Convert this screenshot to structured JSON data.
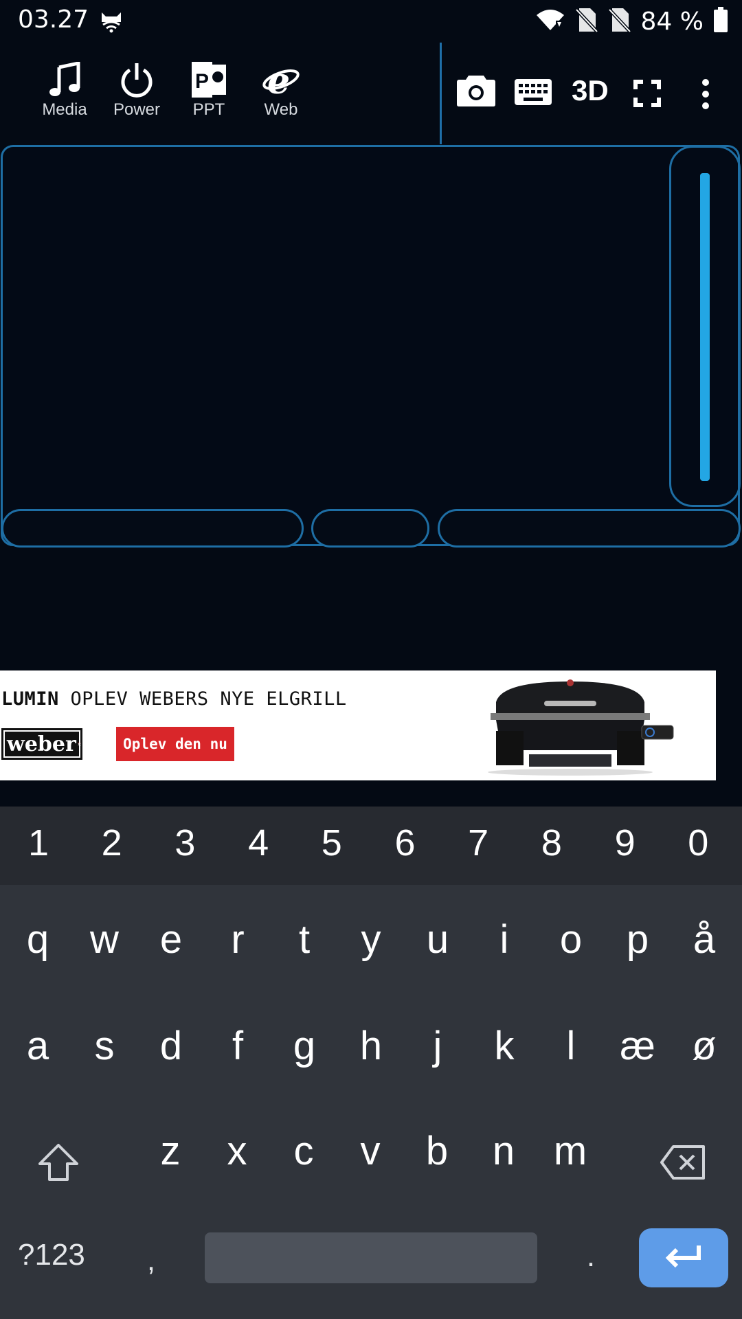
{
  "status_bar": {
    "time": "03.27",
    "battery_percent": "84 %",
    "icons": [
      "cat-notification-icon",
      "wifi-icon",
      "no-sim-icon",
      "no-sim-icon",
      "battery-icon"
    ]
  },
  "toolbar": {
    "left_buttons": [
      {
        "label": "Media",
        "icon": "music-note-icon"
      },
      {
        "label": "Power",
        "icon": "power-icon"
      },
      {
        "label": "PPT",
        "icon": "powerpoint-icon"
      },
      {
        "label": "Web",
        "icon": "internet-explorer-icon"
      }
    ],
    "right_buttons": [
      {
        "icon": "camera-icon"
      },
      {
        "icon": "keyboard-icon"
      },
      {
        "label": "3D",
        "icon": "3d-text"
      },
      {
        "icon": "fullscreen-icon"
      },
      {
        "icon": "more-vert-icon"
      }
    ]
  },
  "touchpad": {
    "scroll_level": 1.0,
    "mouse_buttons": [
      "left-click",
      "middle-click",
      "right-click"
    ]
  },
  "ad": {
    "brand_word": "LUMIN",
    "headline_rest": "OPLEV WEBERS NYE ELGRILL",
    "logo_text": "weber",
    "cta": "Oplev den nu",
    "accent": "#d9262a"
  },
  "keyboard": {
    "number_row": [
      "1",
      "2",
      "3",
      "4",
      "5",
      "6",
      "7",
      "8",
      "9",
      "0"
    ],
    "row1": [
      "q",
      "w",
      "e",
      "r",
      "t",
      "y",
      "u",
      "i",
      "o",
      "p",
      "å"
    ],
    "row2": [
      "a",
      "s",
      "d",
      "f",
      "g",
      "h",
      "j",
      "k",
      "l",
      "æ",
      "ø"
    ],
    "row3": [
      "z",
      "x",
      "c",
      "v",
      "b",
      "n",
      "m"
    ],
    "symbols_label": "?123",
    "comma": ",",
    "period": ".",
    "enter_color": "#5e9ce8"
  }
}
